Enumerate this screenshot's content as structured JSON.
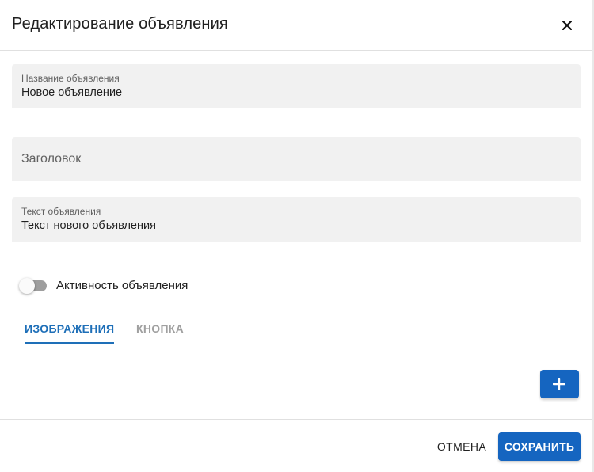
{
  "dialog": {
    "title": "Редактирование объявления",
    "close_icon": "close-icon"
  },
  "fields": {
    "name": {
      "label": "Название объявления",
      "value": "Новое объявление"
    },
    "heading": {
      "placeholder": "Заголовок",
      "value": ""
    },
    "text": {
      "label": "Текст объявления",
      "value": "Текст нового объявления"
    }
  },
  "active_toggle": {
    "label": "Активность объявления",
    "on": false
  },
  "tabs": [
    {
      "label": "ИЗОБРАЖЕНИЯ",
      "selected": true
    },
    {
      "label": "КНОПКА",
      "selected": false
    }
  ],
  "add_button": {
    "icon": "plus-icon"
  },
  "footer": {
    "cancel_label": "ОТМЕНА",
    "save_label": "СОХРАНИТЬ"
  },
  "colors": {
    "primary": "#1565c0",
    "tab_active": "#1e6fb8",
    "field_background": "#f1f1f1"
  }
}
